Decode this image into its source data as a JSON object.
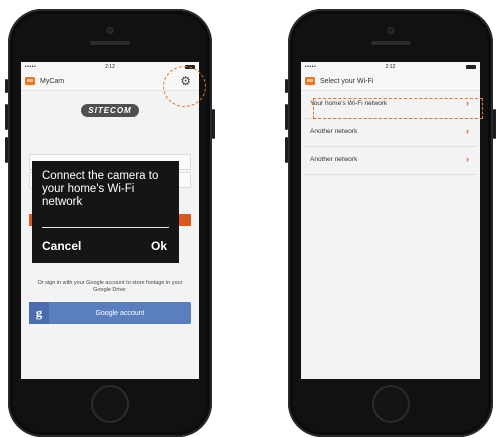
{
  "status_bar": {
    "signal": "••••• ",
    "time": "2:12"
  },
  "left_screen": {
    "app_title": "MyCam",
    "logo_text": "SITECOM",
    "dialog": {
      "message": "Connect the camera to your home's Wi-Fi network",
      "cancel_label": "Cancel",
      "ok_label": "Ok"
    },
    "signin_text": "Or sign in with your Google account to store footage in your Google Drive:",
    "google_button": {
      "icon_letter": "g",
      "label": "Google account"
    }
  },
  "right_screen": {
    "title": "Select your Wi-Fi",
    "networks": [
      {
        "label": "Your home's Wi-Fi network",
        "chevron": "›"
      },
      {
        "label": "Another network",
        "chevron": "›"
      },
      {
        "label": "Another network",
        "chevron": "›"
      }
    ]
  },
  "colors": {
    "accent": "#e05a1e",
    "google_blue": "#5a7fc1",
    "dialog_bg": "#151515",
    "callout": "#e0762c"
  },
  "icons": {
    "settings": "gear-icon",
    "wifi": "wifi-icon",
    "app": "mycam-app-icon"
  }
}
